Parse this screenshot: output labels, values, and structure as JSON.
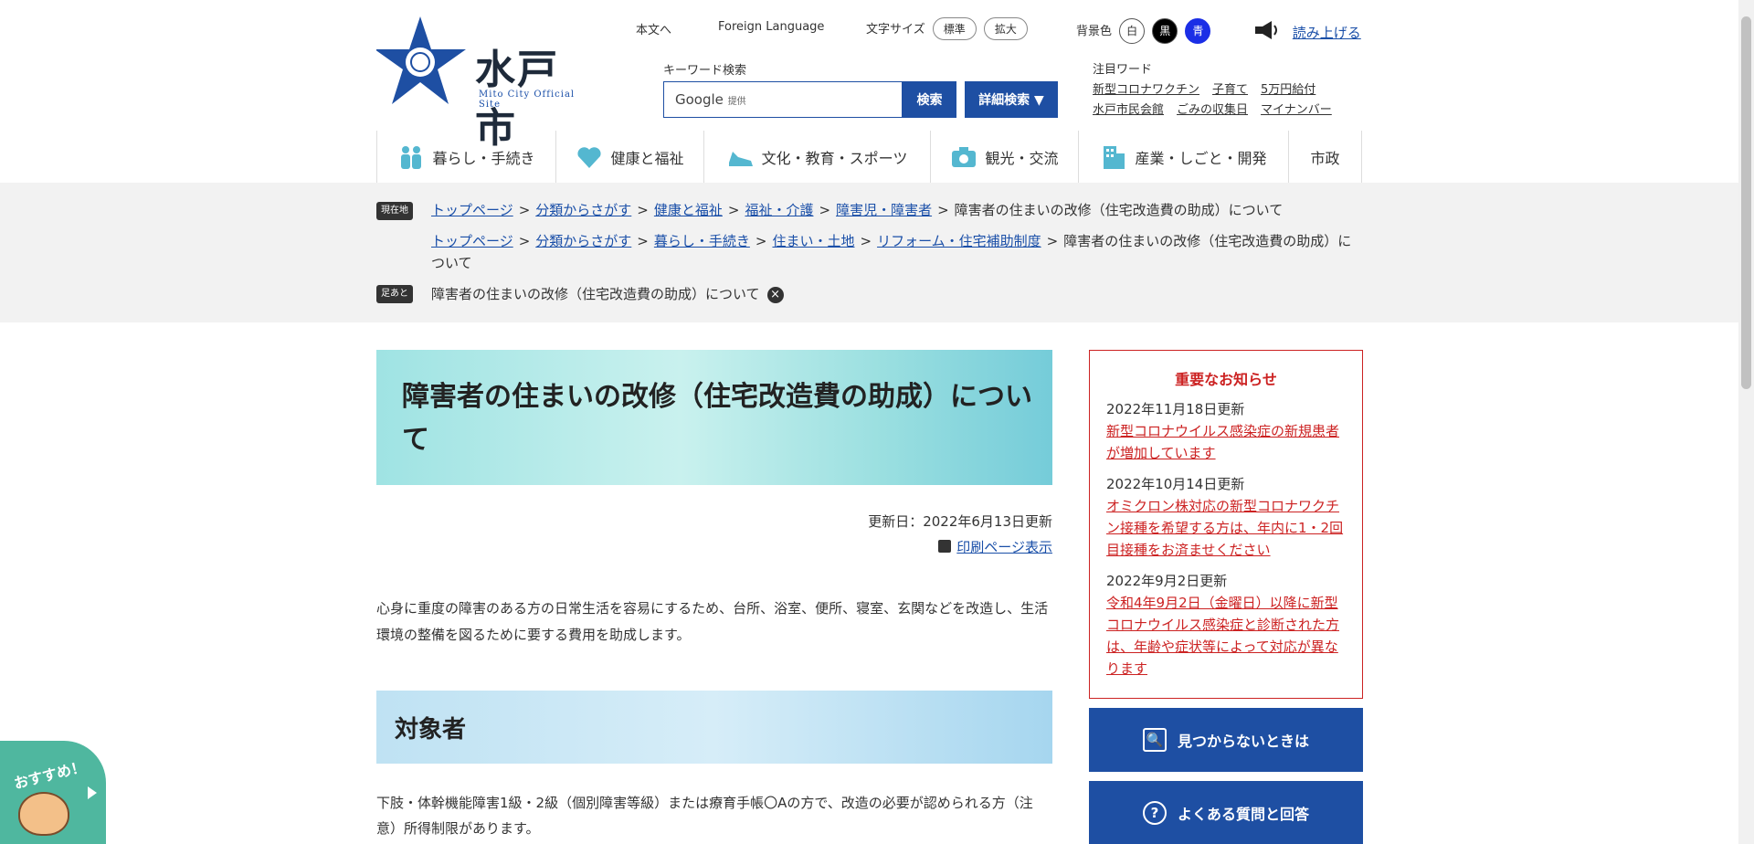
{
  "header": {
    "logo_name": "水戸市",
    "logo_sub": "Mito City Official Site",
    "skip_link": "本文へ",
    "foreign_language": "Foreign Language",
    "font_size_label": "文字サイズ",
    "font_size_standard": "標準",
    "font_size_large": "拡大",
    "bg_label": "背景色",
    "bg_white": "白",
    "bg_black": "黒",
    "bg_blue": "青",
    "read_aloud": "読み上げる",
    "keyword_label": "キーワード検索",
    "search_provider": "Google",
    "search_provider_note": "提供",
    "search_button": "検索",
    "advanced_button": "詳細検索 ▼",
    "hot_label": "注目ワード",
    "hot_words": [
      "新型コロナワクチン",
      "子育て",
      "5万円給付",
      "水戸市民会館",
      "ごみの収集日",
      "マイナンバー"
    ]
  },
  "nav": [
    "暮らし・手続き",
    "健康と福祉",
    "文化・教育・スポーツ",
    "観光・交流",
    "産業・しごと・開発",
    "市政"
  ],
  "breadcrumbs": {
    "current_tag": "現在地",
    "footprint_tag": "足あと",
    "trail1": [
      "トップページ",
      "分類からさがす",
      "健康と福祉",
      "福祉・介護",
      "障害児・障害者"
    ],
    "trail1_current": "障害者の住まいの改修（住宅改造費の助成）について",
    "trail2": [
      "トップページ",
      "分類からさがす",
      "暮らし・手続き",
      "住まい・土地",
      "リフォーム・住宅補助制度"
    ],
    "trail2_current": "障害者の住まいの改修（住宅改造費の助成）について",
    "footprint": "障害者の住まいの改修（住宅改造費の助成）について"
  },
  "main": {
    "title": "障害者の住まいの改修（住宅改造費の助成）について",
    "updated": "更新日：2022年6月13日更新",
    "print": "印刷ページ表示",
    "intro": "心身に重度の障害のある方の日常生活を容易にするため、台所、浴室、便所、寝室、玄関などを改造し、生活環境の整備を図るために要する費用を助成します。",
    "section_heading": "対象者",
    "target_text": "下肢・体幹機能障害1級・2級（個別障害等級）または療育手帳〇Aの方で、改造の必要が認められる方（注意）所得制限があります。"
  },
  "notice": {
    "title": "重要なお知らせ",
    "items": [
      {
        "date": "2022年11月18日更新",
        "text": "新型コロナウイルス感染症の新規患者が増加しています"
      },
      {
        "date": "2022年10月14日更新",
        "text": "オミクロン株対応の新型コロナワクチン接種を希望する方は、年内に1・2回目接種をお済ませください"
      },
      {
        "date": "2022年9月2日更新",
        "text": "令和4年9月2日（金曜日）以降に新型コロナウイルス感染症と診断された方は、年齢や症状等によって対応が異なります"
      }
    ]
  },
  "side_buttons": {
    "not_found": "見つからないときは",
    "faq": "よくある質問と回答"
  },
  "recommend": "おすすめ！",
  "colors": {
    "brand": "#1e4fa3",
    "notice": "#cc2222",
    "accent": "#4fb79f"
  }
}
